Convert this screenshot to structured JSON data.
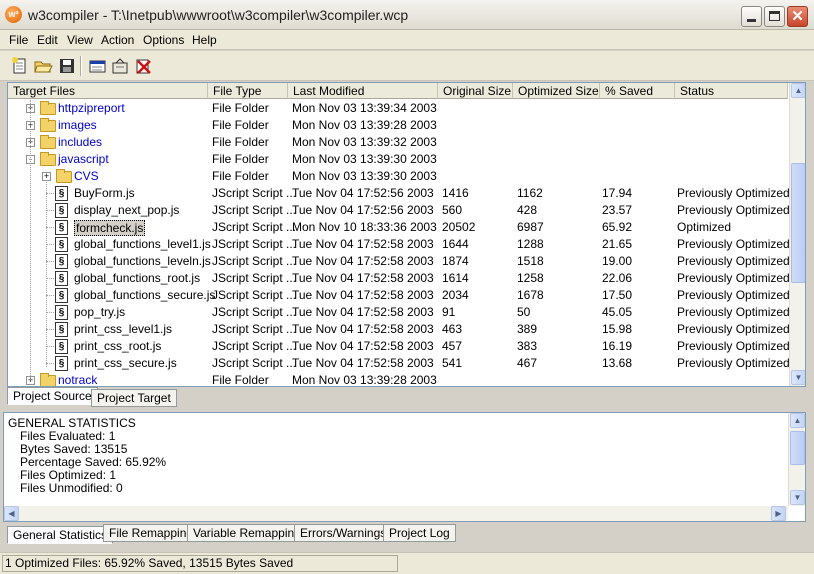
{
  "title": "w3compiler - T:\\Inetpub\\wwwroot\\w3compiler\\w3compiler.wcp",
  "menu": [
    "File",
    "Edit",
    "View",
    "Action",
    "Options",
    "Help"
  ],
  "toolbar": {
    "icons": [
      "new-project-icon",
      "open-project-icon",
      "save-project-icon",
      "target-files-icon",
      "optimize-icon",
      "clear-icon"
    ]
  },
  "columns": [
    "Target Files",
    "File Type",
    "Last Modified",
    "Original Size",
    "Optimized Size",
    "% Saved",
    "Status"
  ],
  "rows": [
    {
      "name": "httpzipreport",
      "type": "File Folder",
      "modified": "Mon Nov 03 13:39:34 2003",
      "orig": "",
      "opt": "",
      "saved": "",
      "status": "",
      "kind": "folder",
      "expander": "+"
    },
    {
      "name": "images",
      "type": "File Folder",
      "modified": "Mon Nov 03 13:39:28 2003",
      "orig": "",
      "opt": "",
      "saved": "",
      "status": "",
      "kind": "folder",
      "expander": "+"
    },
    {
      "name": "includes",
      "type": "File Folder",
      "modified": "Mon Nov 03 13:39:32 2003",
      "orig": "",
      "opt": "",
      "saved": "",
      "status": "",
      "kind": "folder",
      "expander": "+"
    },
    {
      "name": "javascript",
      "type": "File Folder",
      "modified": "Mon Nov 03 13:39:30 2003",
      "orig": "",
      "opt": "",
      "saved": "",
      "status": "",
      "kind": "folder",
      "expander": "-"
    },
    {
      "name": "CVS",
      "type": "File Folder",
      "modified": "Mon Nov 03 13:39:30 2003",
      "orig": "",
      "opt": "",
      "saved": "",
      "status": "",
      "kind": "subfolder",
      "expander": "+"
    },
    {
      "name": "BuyForm.js",
      "type": "JScript Script ...",
      "modified": "Tue Nov 04 17:52:56 2003",
      "orig": "1416",
      "opt": "1162",
      "saved": "17.94",
      "status": "Previously Optimized",
      "kind": "file"
    },
    {
      "name": "display_next_pop.js",
      "type": "JScript Script ...",
      "modified": "Tue Nov 04 17:52:56 2003",
      "orig": "560",
      "opt": "428",
      "saved": "23.57",
      "status": "Previously Optimized",
      "kind": "file"
    },
    {
      "name": "formcheck.js",
      "type": "JScript Script ...",
      "modified": "Mon Nov 10 18:33:36 2003",
      "orig": "20502",
      "opt": "6987",
      "saved": "65.92",
      "status": "Optimized",
      "kind": "file",
      "selected": true
    },
    {
      "name": "global_functions_level1.js",
      "type": "JScript Script ...",
      "modified": "Tue Nov 04 17:52:58 2003",
      "orig": "1644",
      "opt": "1288",
      "saved": "21.65",
      "status": "Previously Optimized",
      "kind": "file"
    },
    {
      "name": "global_functions_leveln.js",
      "type": "JScript Script ...",
      "modified": "Tue Nov 04 17:52:58 2003",
      "orig": "1874",
      "opt": "1518",
      "saved": "19.00",
      "status": "Previously Optimized",
      "kind": "file"
    },
    {
      "name": "global_functions_root.js",
      "type": "JScript Script ...",
      "modified": "Tue Nov 04 17:52:58 2003",
      "orig": "1614",
      "opt": "1258",
      "saved": "22.06",
      "status": "Previously Optimized",
      "kind": "file"
    },
    {
      "name": "global_functions_secure.js",
      "type": "JScript Script ...",
      "modified": "Tue Nov 04 17:52:58 2003",
      "orig": "2034",
      "opt": "1678",
      "saved": "17.50",
      "status": "Previously Optimized",
      "kind": "file"
    },
    {
      "name": "pop_try.js",
      "type": "JScript Script ...",
      "modified": "Tue Nov 04 17:52:58 2003",
      "orig": "91",
      "opt": "50",
      "saved": "45.05",
      "status": "Previously Optimized",
      "kind": "file"
    },
    {
      "name": "print_css_level1.js",
      "type": "JScript Script ...",
      "modified": "Tue Nov 04 17:52:58 2003",
      "orig": "463",
      "opt": "389",
      "saved": "15.98",
      "status": "Previously Optimized",
      "kind": "file"
    },
    {
      "name": "print_css_root.js",
      "type": "JScript Script ...",
      "modified": "Tue Nov 04 17:52:58 2003",
      "orig": "457",
      "opt": "383",
      "saved": "16.19",
      "status": "Previously Optimized",
      "kind": "file"
    },
    {
      "name": "print_css_secure.js",
      "type": "JScript Script ...",
      "modified": "Tue Nov 04 17:52:58 2003",
      "orig": "541",
      "opt": "467",
      "saved": "13.68",
      "status": "Previously Optimized",
      "kind": "file"
    },
    {
      "name": "notrack",
      "type": "File Folder",
      "modified": "Mon Nov 03 13:39:28 2003",
      "orig": "",
      "opt": "",
      "saved": "",
      "status": "",
      "kind": "folder",
      "expander": "+"
    }
  ],
  "project_tabs": [
    "Project Source",
    "Project Target"
  ],
  "stats": {
    "heading": "GENERAL STATISTICS",
    "lines": [
      "Files Evaluated: 1",
      "Bytes Saved: 13515",
      "Percentage Saved: 65.92%",
      "Files Optimized: 1",
      "Files Unmodified: 0"
    ]
  },
  "bottom_tabs": [
    "General Statistics",
    "File Remapping",
    "Variable Remapping",
    "Errors/Warnings",
    "Project Log"
  ],
  "status_bar": "1 Optimized Files: 65.92% Saved, 13515 Bytes Saved"
}
